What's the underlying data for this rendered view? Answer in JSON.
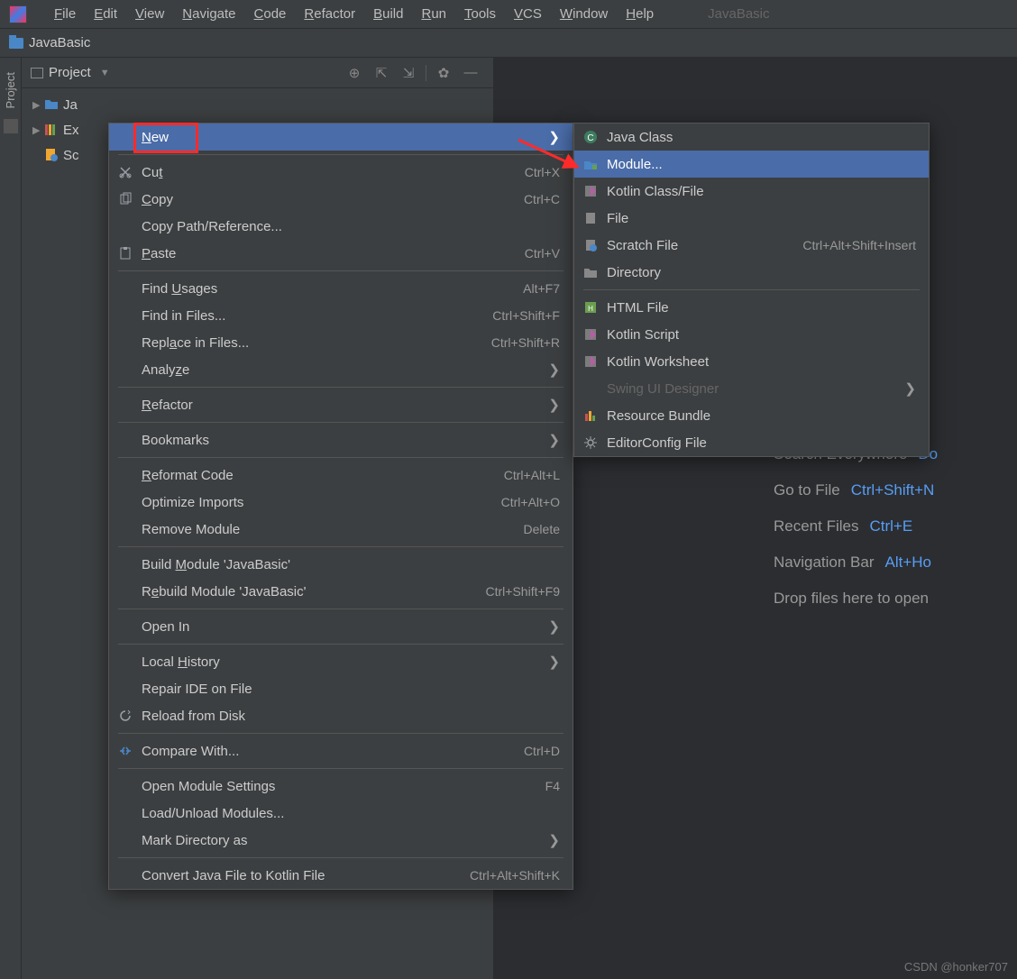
{
  "window": {
    "title": "JavaBasic"
  },
  "menubar": [
    "File",
    "Edit",
    "View",
    "Navigate",
    "Code",
    "Refactor",
    "Build",
    "Run",
    "Tools",
    "VCS",
    "Window",
    "Help"
  ],
  "breadcrumb": {
    "project": "JavaBasic"
  },
  "toolwindow": {
    "title": "Project"
  },
  "tree": {
    "n1": "Ja",
    "n2": "Ex",
    "n3": "Sc"
  },
  "context_menu": [
    {
      "label": "New",
      "u": "N",
      "submenu": true,
      "highlighted": true
    },
    "-",
    {
      "icon": "cut",
      "label": "Cut",
      "u": "t",
      "shortcut": "Ctrl+X"
    },
    {
      "icon": "copy",
      "label": "Copy",
      "u": "C",
      "shortcut": "Ctrl+C"
    },
    {
      "label": "Copy Path/Reference..."
    },
    {
      "icon": "paste",
      "label": "Paste",
      "u": "P",
      "shortcut": "Ctrl+V"
    },
    "-",
    {
      "label": "Find Usages",
      "u": "U",
      "shortcut": "Alt+F7"
    },
    {
      "label": "Find in Files...",
      "shortcut": "Ctrl+Shift+F"
    },
    {
      "label": "Replace in Files...",
      "u": "a",
      "shortcut": "Ctrl+Shift+R"
    },
    {
      "label": "Analyze",
      "u": "z",
      "submenu": true
    },
    "-",
    {
      "label": "Refactor",
      "u": "R",
      "submenu": true
    },
    "-",
    {
      "label": "Bookmarks",
      "submenu": true
    },
    "-",
    {
      "label": "Reformat Code",
      "u": "R",
      "shortcut": "Ctrl+Alt+L"
    },
    {
      "label": "Optimize Imports",
      "shortcut": "Ctrl+Alt+O"
    },
    {
      "label": "Remove Module",
      "shortcut": "Delete"
    },
    "-",
    {
      "label": "Build Module 'JavaBasic'",
      "u": "M"
    },
    {
      "label": "Rebuild Module 'JavaBasic'",
      "u": "e",
      "shortcut": "Ctrl+Shift+F9"
    },
    "-",
    {
      "label": "Open In",
      "submenu": true
    },
    "-",
    {
      "label": "Local History",
      "u": "H",
      "submenu": true
    },
    {
      "label": "Repair IDE on File"
    },
    {
      "icon": "reload",
      "label": "Reload from Disk"
    },
    "-",
    {
      "icon": "compare",
      "label": "Compare With...",
      "shortcut": "Ctrl+D"
    },
    "-",
    {
      "label": "Open Module Settings",
      "shortcut": "F4"
    },
    {
      "label": "Load/Unload Modules..."
    },
    {
      "label": "Mark Directory as",
      "submenu": true
    },
    "-",
    {
      "label": "Convert Java File to Kotlin File",
      "shortcut": "Ctrl+Alt+Shift+K"
    }
  ],
  "new_submenu": [
    {
      "icon": "class",
      "label": "Java Class"
    },
    {
      "icon": "module",
      "label": "Module...",
      "highlighted": true
    },
    {
      "icon": "kotlin",
      "label": "Kotlin Class/File"
    },
    {
      "icon": "file",
      "label": "File"
    },
    {
      "icon": "scratch",
      "label": "Scratch File",
      "shortcut": "Ctrl+Alt+Shift+Insert"
    },
    {
      "icon": "dir",
      "label": "Directory"
    },
    "-",
    {
      "icon": "html",
      "label": "HTML File"
    },
    {
      "icon": "kotlin",
      "label": "Kotlin Script"
    },
    {
      "icon": "kotlin",
      "label": "Kotlin Worksheet"
    },
    {
      "label": "Swing UI Designer",
      "disabled": true,
      "submenu": true
    },
    {
      "icon": "bundle",
      "label": "Resource Bundle"
    },
    {
      "icon": "gear",
      "label": "EditorConfig File"
    }
  ],
  "hints": [
    {
      "label": "Search Everywhere",
      "key": "Do"
    },
    {
      "label": "Go to File",
      "key": "Ctrl+Shift+N"
    },
    {
      "label": "Recent Files",
      "key": "Ctrl+E"
    },
    {
      "label": "Navigation Bar",
      "key": "Alt+Ho"
    },
    {
      "label": "Drop files here to open "
    }
  ],
  "watermark": "CSDN @honker707"
}
